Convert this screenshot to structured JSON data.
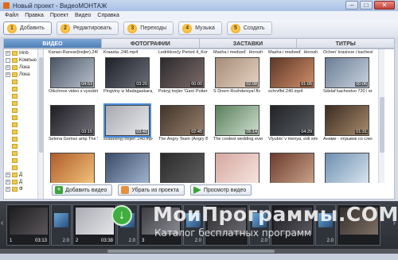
{
  "window": {
    "title": "Новый проект - ВидеоМОНТАЖ",
    "min": "–",
    "max": "□",
    "close": "✕"
  },
  "menu": [
    "Файл",
    "Правка",
    "Проект",
    "Видео",
    "Справка"
  ],
  "steps": [
    {
      "num": "1",
      "label": "Добавить"
    },
    {
      "num": "2",
      "label": "Редактировать"
    },
    {
      "num": "3",
      "label": "Переходы"
    },
    {
      "num": "4",
      "label": "Музыка"
    },
    {
      "num": "5",
      "label": "Создать"
    }
  ],
  "tabs": [
    "ВИДЕО",
    "ФОТОГРАФИИ",
    "ЗАСТАВКИ",
    "ТИТРЫ"
  ],
  "tree": [
    {
      "exp": "+",
      "label": "Irinb"
    },
    {
      "exp": "-",
      "label": "Компью"
    },
    {
      "exp": "+",
      "label": "Лока"
    },
    {
      "exp": "+",
      "label": "Лока"
    },
    {
      "exp": "",
      "label": ""
    },
    {
      "exp": "",
      "label": ""
    },
    {
      "exp": "",
      "label": ""
    },
    {
      "exp": "",
      "label": ""
    },
    {
      "exp": "",
      "label": ""
    },
    {
      "exp": "",
      "label": ""
    },
    {
      "exp": "",
      "label": ""
    },
    {
      "exp": "",
      "label": ""
    },
    {
      "exp": "",
      "label": ""
    },
    {
      "exp": "",
      "label": ""
    },
    {
      "exp": "",
      "label": ""
    },
    {
      "exp": "",
      "label": ""
    },
    {
      "exp": "",
      "label": ""
    },
    {
      "exp": "+",
      "label": "Д"
    },
    {
      "exp": "+",
      "label": "Д"
    },
    {
      "exp": "+",
      "label": "Ф"
    }
  ],
  "grid_captions_top": [
    "Kanan-Ranvar(trejler).240...",
    "Kraasta..240.mp4",
    "Ledrikkov(y Period 4_Kont...",
    "Masha i medved'. Horoshe...",
    "Masha i medved'. Horoshe...",
    "Ochen' krasivoe i kachestv..."
  ],
  "grid_rows": [
    {
      "items": [
        {
          "cap": "Otkchnoe video s vysokim ...",
          "dur": "04:53",
          "c1": "#4a5565",
          "c2": "#b9c1cc"
        },
        {
          "cap": "Pingviny iz Madagaskara_...",
          "dur": "03:20",
          "c1": "#1f2229",
          "c2": "#6b6e77"
        },
        {
          "cap": "Pokryj trejler 'Garri Pottera...",
          "dur": "00:00",
          "c1": "#2d2a2d",
          "c2": "#7d6b6a"
        },
        {
          "cap": "S Dnem Rozhdeniya!.flv",
          "dur": "02:08",
          "c1": "#a58c78",
          "c2": "#e7d3c3"
        },
        {
          "cap": "schrvffel.240.mp4",
          "dur": "01:05",
          "c1": "#5c3727",
          "c2": "#d18f69"
        },
        {
          "cap": "Sdelaf kachestvo 720 i ena...",
          "dur": "00:06",
          "c1": "#6b7e96",
          "c2": "#c9d2de"
        }
      ]
    },
    {
      "items": [
        {
          "cap": "Selena Gomez amp The Sc...",
          "dur": "03:15",
          "c1": "#1c1d22",
          "c2": "#74717a"
        },
        {
          "cap": "svadebnyj trejler..240.mp4",
          "dur": "03:40",
          "c1": "#a7a9b0",
          "c2": "#e9eaec",
          "selected": true
        },
        {
          "cap": "The Angry Team (Angry Bi...",
          "dur": "02:45",
          "c1": "#40342a",
          "c2": "#98816c"
        },
        {
          "cap": "The coolest wedding ever ...",
          "dur": "05:14",
          "c1": "#5a7e5c",
          "c2": "#cfe0cf"
        },
        {
          "cap": "Vlyubis' v menya, esli smo...",
          "dur": "04:29",
          "c1": "#202226",
          "c2": "#585b60"
        },
        {
          "cap": "Аниме - отрывок со слени...",
          "dur": "01:31",
          "c1": "#3b2b22",
          "c2": "#a98c6c"
        }
      ]
    },
    {
      "items": [
        {
          "cap": "",
          "dur": "",
          "c1": "#b05c2a",
          "c2": "#f0c27a"
        },
        {
          "cap": "",
          "dur": "",
          "c1": "#3a4a66",
          "c2": "#9fb3cf"
        },
        {
          "cap": "",
          "dur": "",
          "c1": "#2a2a2a",
          "c2": "#5e5e5e"
        },
        {
          "cap": "",
          "dur": "",
          "c1": "#d5a7a0",
          "c2": "#f6e4de"
        },
        {
          "cap": "",
          "dur": "",
          "c1": "#6a3b2c",
          "c2": "#c9a189"
        },
        {
          "cap": "",
          "dur": "",
          "c1": "#6d8fb0",
          "c2": "#d8e4ef"
        }
      ]
    }
  ],
  "actions": {
    "add": "Добавить видео",
    "remove": "Убрать из проекта",
    "preview": "Просмотр видео"
  },
  "timeline": {
    "clips": [
      {
        "idx": "1",
        "time": "03:13",
        "c1": "#1d1d20",
        "c2": "#5b5659"
      },
      {
        "idx": "2",
        "time": "03:38",
        "c1": "#a9abb2",
        "c2": "#e4e5e8"
      },
      {
        "idx": "3",
        "time": "",
        "c1": "#3c3c42",
        "c2": "#8b8b93"
      },
      {
        "idx": "",
        "time": "",
        "c1": "#2c2c30",
        "c2": "#6a6a70"
      },
      {
        "idx": "",
        "time": "",
        "c1": "#1a1a1f",
        "c2": "#5a5a60"
      },
      {
        "idx": "",
        "time": "",
        "c1": "#332e2b",
        "c2": "#7e6f64"
      }
    ],
    "transitions": [
      "2.0",
      "2.0",
      "2.0",
      "2.0",
      "2.0"
    ]
  },
  "watermark": {
    "big": "МоиПрограммы.COM",
    "small": "Каталог бесплатных программ"
  }
}
